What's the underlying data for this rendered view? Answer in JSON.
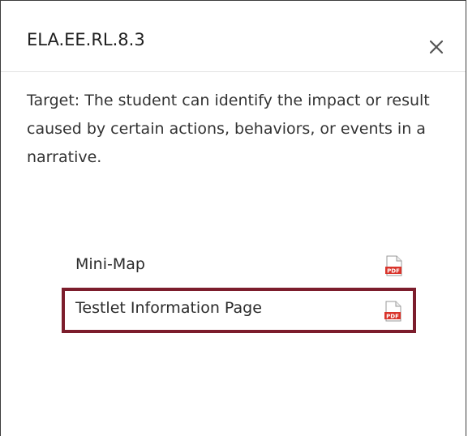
{
  "dialog": {
    "title": "ELA.EE.RL.8.3",
    "close_label": "×",
    "description": "Target: The student can identify the impact or result caused by certain actions, behaviors, or events in a narrative."
  },
  "documents": [
    {
      "label": "Mini-Map",
      "icon": "pdf-icon",
      "selected": false
    },
    {
      "label": "Testlet Information Page",
      "icon": "pdf-icon",
      "selected": true
    }
  ],
  "colors": {
    "selection_border": "#7c1d2c",
    "pdf_badge": "#d9342b"
  },
  "icon_text": {
    "pdf": "PDF"
  }
}
